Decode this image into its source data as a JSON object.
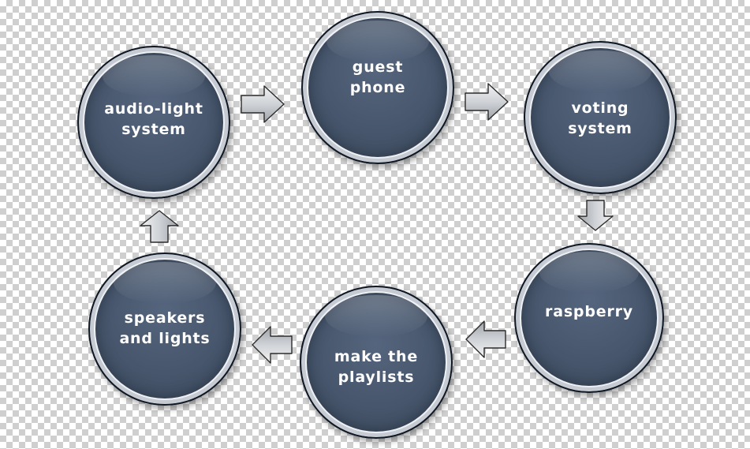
{
  "nodes": [
    {
      "id": "n1",
      "label": "audio-light\nsystem"
    },
    {
      "id": "n2",
      "label": "guest\nphone"
    },
    {
      "id": "n3",
      "label": "voting\nsystem"
    },
    {
      "id": "n4",
      "label": "raspberry"
    },
    {
      "id": "n5",
      "label": "make the\nplaylists"
    },
    {
      "id": "n6",
      "label": "speakers\nand lights"
    }
  ],
  "flow": [
    {
      "from": "audio-light system",
      "to": "guest phone",
      "direction": "right"
    },
    {
      "from": "guest phone",
      "to": "voting system",
      "direction": "right"
    },
    {
      "from": "voting system",
      "to": "raspberry",
      "direction": "down"
    },
    {
      "from": "raspberry",
      "to": "make the playlists",
      "direction": "left"
    },
    {
      "from": "make the playlists",
      "to": "speakers and lights",
      "direction": "left"
    },
    {
      "from": "speakers and lights",
      "to": "audio-light system",
      "direction": "up"
    }
  ],
  "colors": {
    "node_fill": "#46556b",
    "node_rim": "#c6cbd3",
    "node_border": "#0f1722",
    "label_text": "#ffffff",
    "arrow_fill": "#cfd2d6",
    "arrow_stroke": "#2b2b2b"
  }
}
